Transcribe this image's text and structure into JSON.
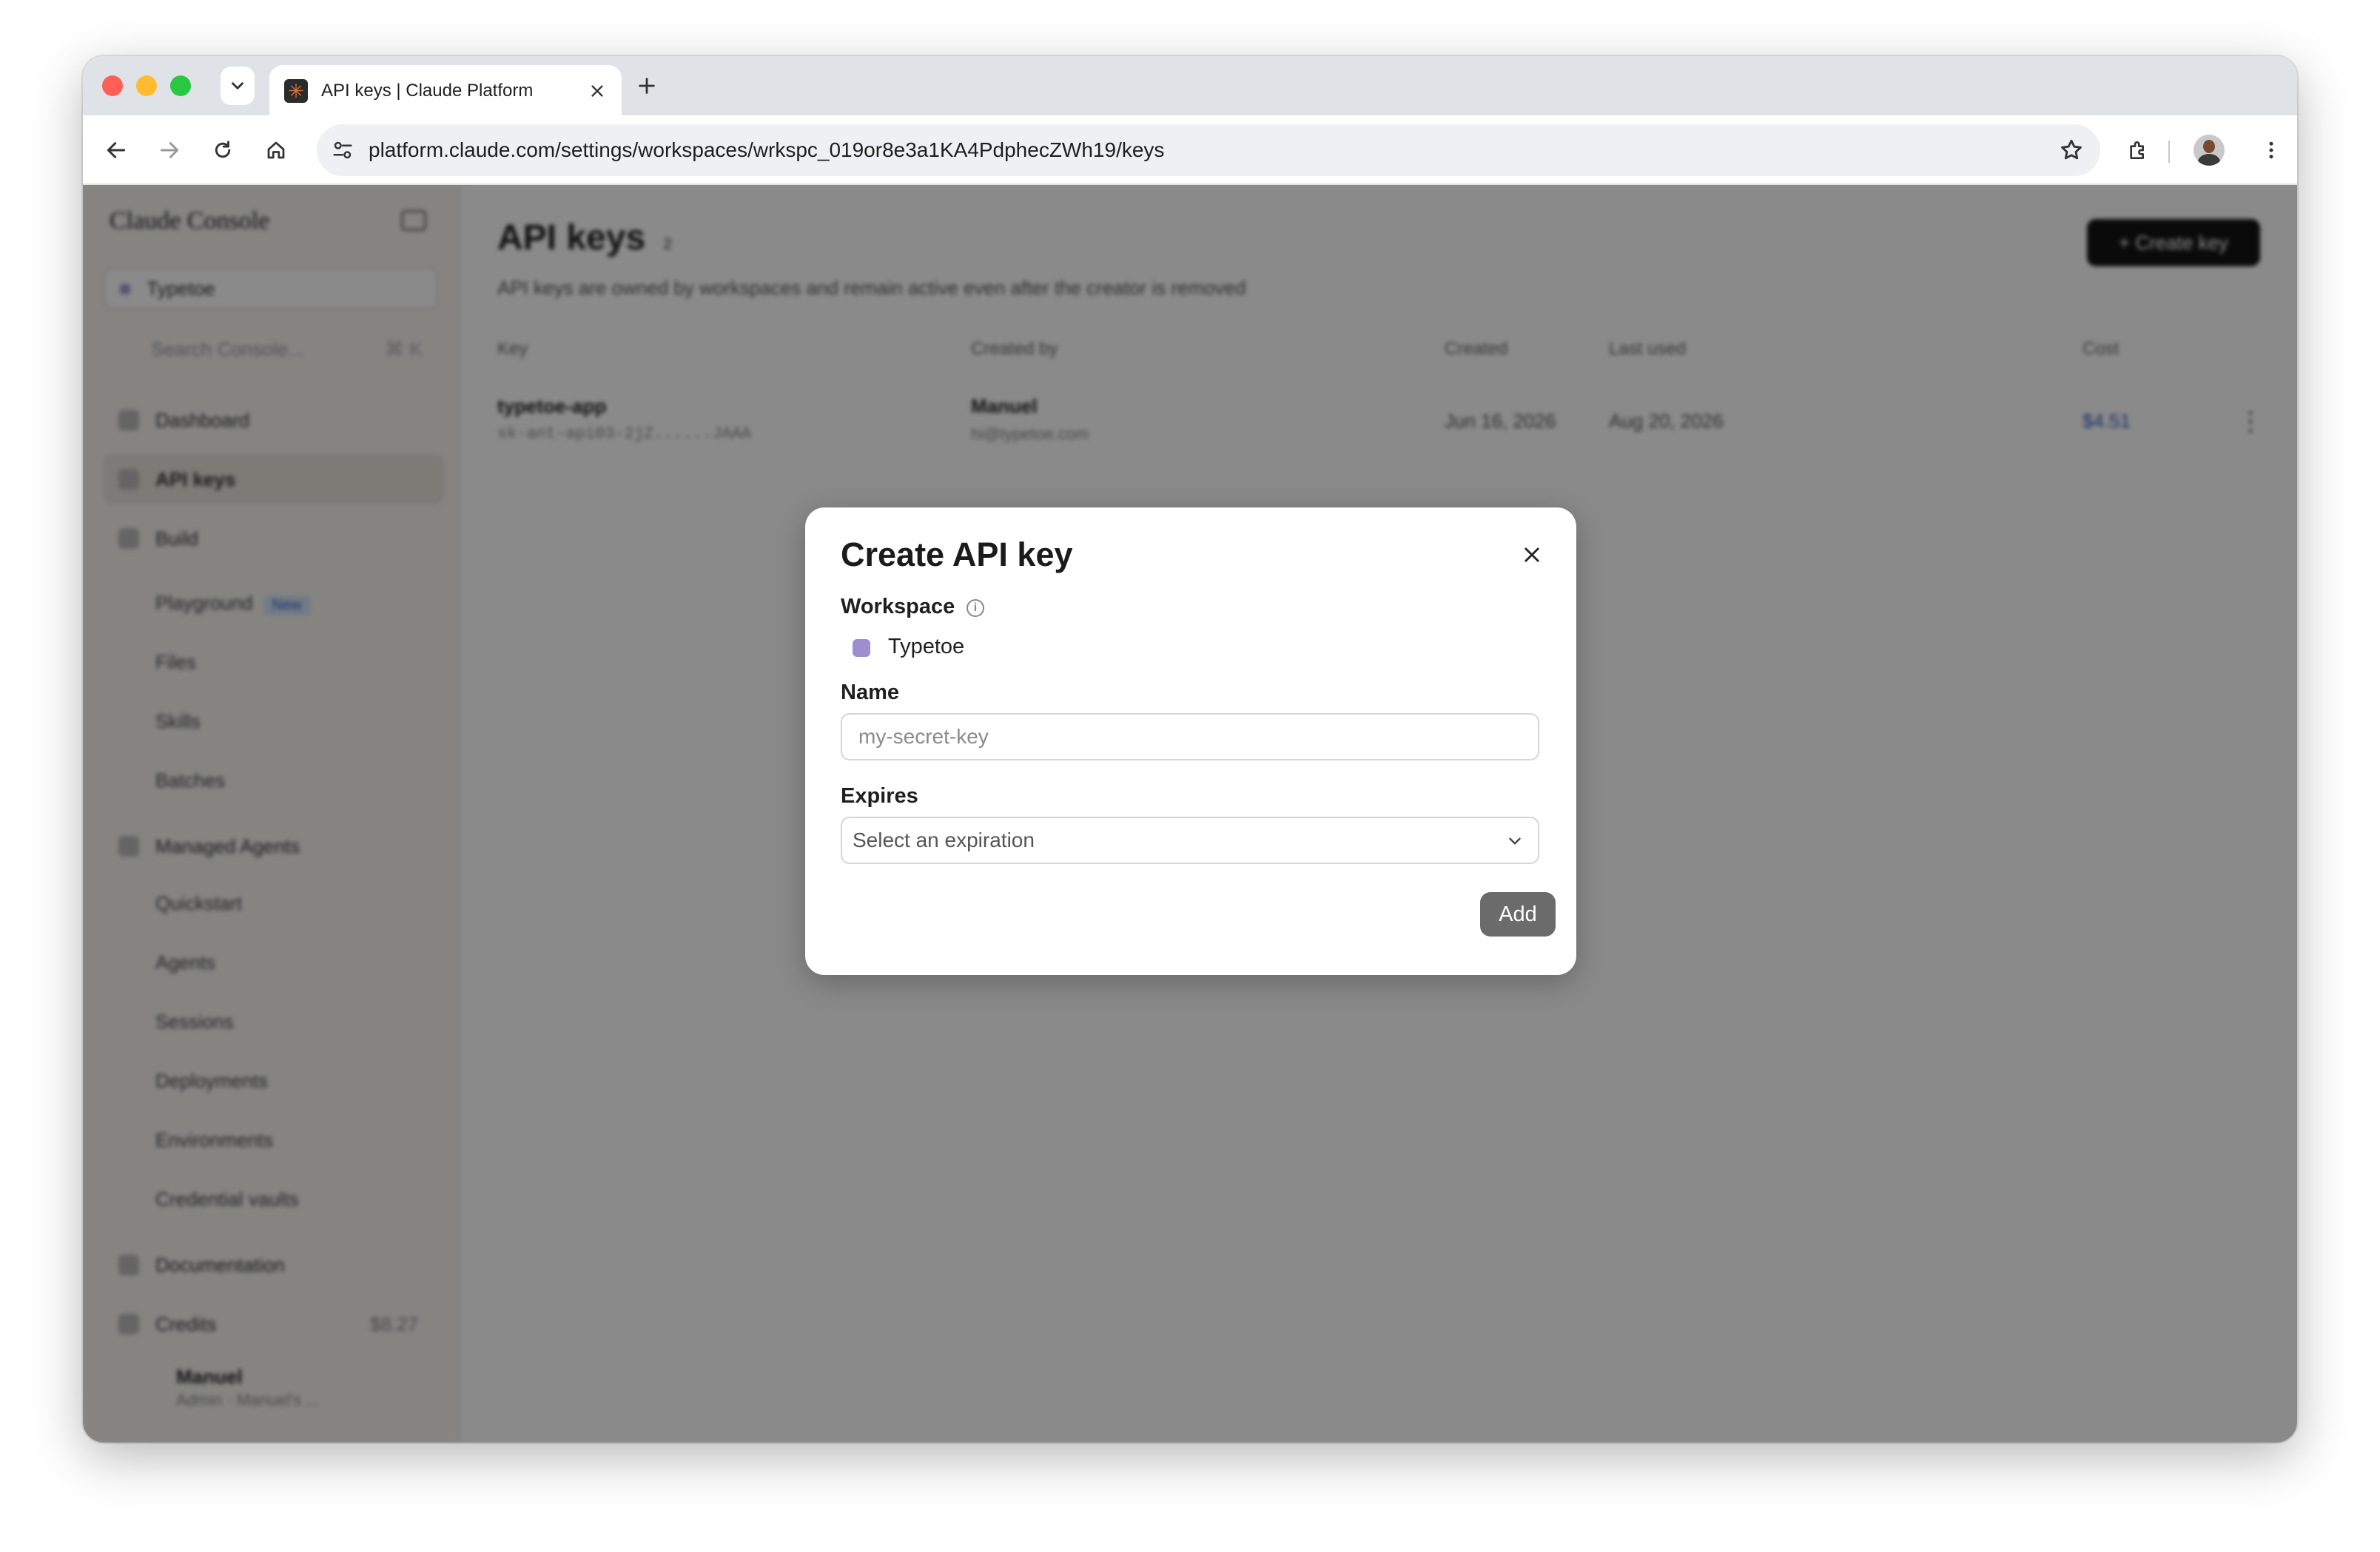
{
  "browser": {
    "tab_title": "API keys | Claude Platform",
    "url": "platform.claude.com/settings/workspaces/wrkspc_019or8e3a1KA4PdphecZWh19/keys"
  },
  "sidebar": {
    "brand": "Claude Console",
    "workspace": "Typetoe",
    "search_placeholder": "Search Console...",
    "search_shortcut": "⌘ K",
    "items": [
      {
        "label": "Dashboard"
      },
      {
        "label": "API keys"
      },
      {
        "label": "Build"
      },
      {
        "label": "Managed Agents"
      },
      {
        "label": "Documentation"
      },
      {
        "label": "Credits",
        "value": "$8.27"
      }
    ],
    "build_sub": [
      "Playground",
      "Files",
      "Skills",
      "Batches"
    ],
    "new_badge": "New",
    "agents_sub": [
      "Quickstart",
      "Agents",
      "Sessions",
      "Deployments",
      "Environments",
      "Credential vaults"
    ],
    "user_name": "Manuel",
    "user_role": "Admin · Manuel's ..."
  },
  "main": {
    "title": "API keys",
    "count": "2",
    "subtitle": "API keys are owned by workspaces and remain active even after the creator is removed",
    "create_button": "+ Create key",
    "columns": [
      "Key",
      "Created by",
      "Created",
      "Last used",
      "Cost"
    ],
    "row": {
      "key_name": "typetoe-app",
      "key_masked": "sk-ant-api03-2jZ......JAAA",
      "created_by": "Manuel",
      "created_by_email": "hi@typetoe.com",
      "created": "Jun 16, 2026",
      "last_used": "Aug 20, 2026",
      "cost": "$4.51"
    }
  },
  "modal": {
    "title": "Create API key",
    "workspace_label": "Workspace",
    "workspace_value": "Typetoe",
    "name_label": "Name",
    "name_placeholder": "my-secret-key",
    "expires_label": "Expires",
    "expires_placeholder": "Select an expiration",
    "add_button": "Add"
  },
  "colors": {
    "workspace_swatch": "#9d8ed0",
    "add_button_bg": "#6b6b6b",
    "overlay": "rgba(0,0,0,0.46)"
  }
}
